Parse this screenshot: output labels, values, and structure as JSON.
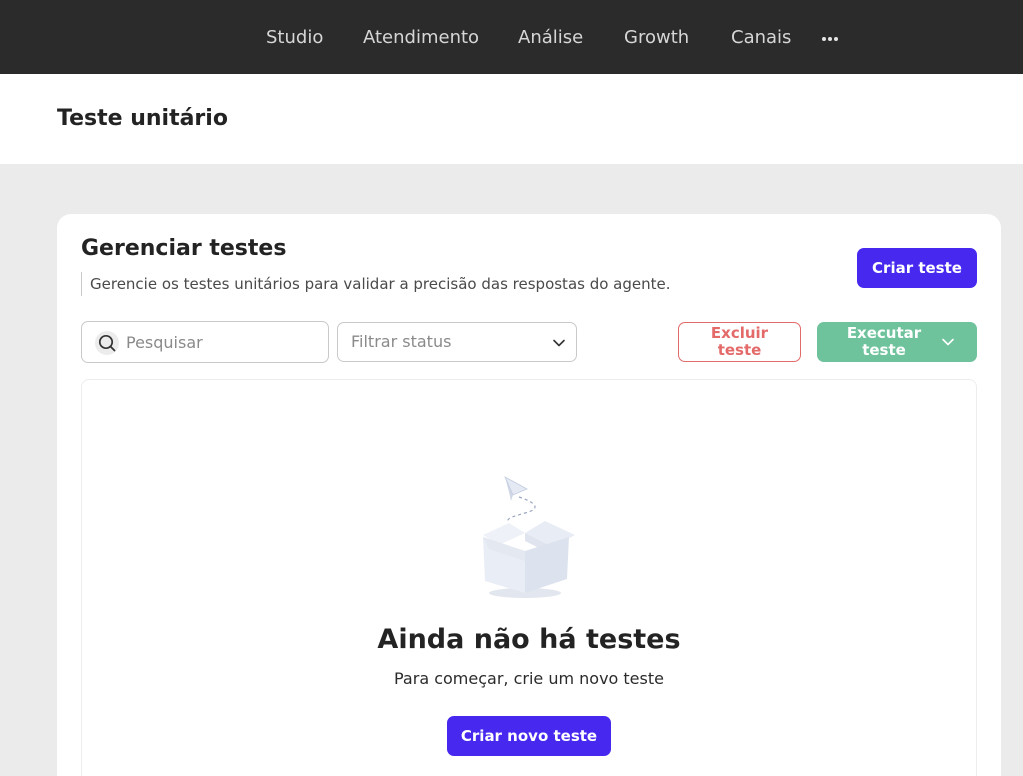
{
  "nav": {
    "items": [
      {
        "label": "Studio"
      },
      {
        "label": "Atendimento"
      },
      {
        "label": "Análise"
      },
      {
        "label": "Growth"
      },
      {
        "label": "Canais"
      }
    ],
    "more_icon": "more-horizontal-icon"
  },
  "page": {
    "title": "Teste unitário"
  },
  "card": {
    "title": "Gerenciar testes",
    "description": "Gerencie os testes unitários para validar a precisão das respostas do agente.",
    "create_button": "Criar teste"
  },
  "toolbar": {
    "search_placeholder": "Pesquisar",
    "search_icon": "search-icon",
    "filter_label": "Filtrar status",
    "delete_button": "Excluir teste",
    "run_button": "Executar teste"
  },
  "empty_state": {
    "illustration": "empty-box-with-paper-plane-icon",
    "title": "Ainda não há testes",
    "subtitle": "Para começar, crie um novo teste",
    "button": "Criar novo teste"
  },
  "colors": {
    "nav_bg": "#2b2b2b",
    "primary": "#4628ef",
    "danger": "#e16a6a",
    "success": "#6fc39c",
    "page_bg": "#ebebeb"
  }
}
